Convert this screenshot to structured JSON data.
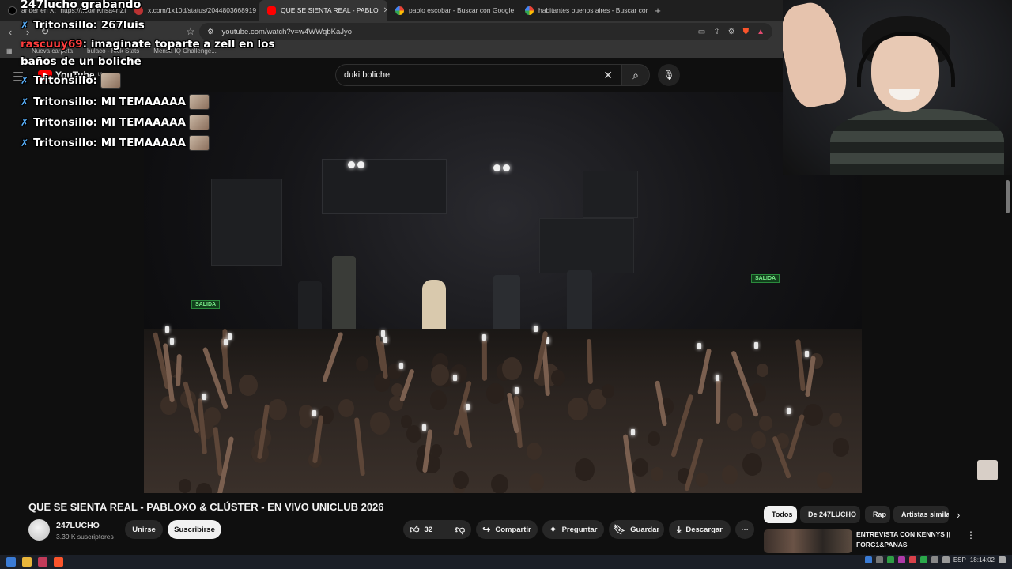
{
  "browser": {
    "tabs": [
      {
        "label": "ánder en X: \"https://t.co/nKhsa4rIZf\"",
        "color": "#111111",
        "active": false
      },
      {
        "label": "x.com/1x10d/status/2044803668919",
        "color": "#cc3333",
        "active": false
      },
      {
        "label": "QUE SE SIENTA REAL - PABLO",
        "color": "#ff0000",
        "active": true
      },
      {
        "label": "pablo escobar - Buscar con Google",
        "color": "#4285f4",
        "active": false
      },
      {
        "label": "habitantes buenos aires - Buscar con",
        "color": "#4285f4",
        "active": false
      }
    ],
    "new_tab": "+",
    "url": "youtube.com/watch?v=w4WWqbKaJyo",
    "bookmarks": [
      "Nueva carpeta",
      "bulaco - Kick Stats",
      "Mensa IQ Challenge..."
    ]
  },
  "chat": {
    "title": "247lucho grabando",
    "messages": [
      {
        "user": "Tritonsillo",
        "text": ": 267luis",
        "emote": false,
        "badge": true
      },
      {
        "user": "rascuuy69",
        "text": ": imaginate toparte a zell en los",
        "text2": "baños de un boliche",
        "emote": false,
        "badge": false
      },
      {
        "user": "Tritonsillo",
        "text": ": ",
        "emote": true,
        "badge": true
      },
      {
        "user": "Tritonsillo",
        "text": ": MI TEMAAAAA",
        "emote": true,
        "badge": true
      },
      {
        "user": "Tritonsillo",
        "text": ": MI TEMAAAAA",
        "emote": true,
        "badge": true
      },
      {
        "user": "Tritonsillo",
        "text": ": MI TEMAAAAA",
        "emote": true,
        "badge": true
      }
    ]
  },
  "youtube": {
    "logo_text": "YouTube",
    "logo_country": "UY",
    "search_value": "duki boliche",
    "video": {
      "exit_sign_left": "SALIDA",
      "exit_sign_right": "SALIDA"
    },
    "title": "QUE SE SIENTA REAL - PABLOXO & CLÚSTER - EN VIVO UNICLUB 2026",
    "channel": {
      "name": "247LUCHO",
      "subscribers": "3.39 K suscriptores",
      "join_label": "Unirse",
      "subscribe_label": "Suscribirse"
    },
    "actions": {
      "likes": "32",
      "share": "Compartir",
      "ask": "Preguntar",
      "save": "Guardar",
      "download": "Descargar"
    },
    "chips": [
      "Todos",
      "De 247LUCHO",
      "Rap",
      "Artistas simila"
    ],
    "recommendation": {
      "title": "ENTREVISTA CON KENNYS || FORG1&PANAS"
    }
  },
  "taskbar": {
    "language": "ESP",
    "time": "18:14:02"
  },
  "colors": {
    "youtube_red": "#ff0000",
    "background": "#0f0f0f",
    "pill": "#272727"
  }
}
